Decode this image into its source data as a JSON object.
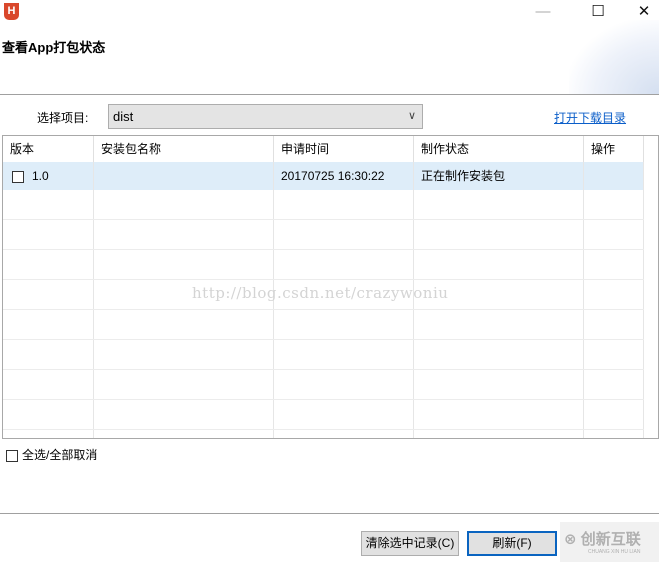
{
  "window": {
    "app_icon": "H",
    "title": "查看App打包状态",
    "minimize": "—",
    "maximize": "☐",
    "close": "✕"
  },
  "project": {
    "label": "选择项目:",
    "value": "dist",
    "open_dir_link": "打开下载目录"
  },
  "table": {
    "columns": [
      "版本",
      "安装包名称",
      "申请时间",
      "制作状态",
      "操作"
    ],
    "rows": [
      {
        "version": "1.0",
        "name": "",
        "time": "20170725 16:30:22",
        "status": "正在制作安装包",
        "action": ""
      }
    ]
  },
  "watermark": "http://blog.csdn.net/crazywoniu",
  "select_all": "全选/全部取消",
  "buttons": {
    "clear": "清除选中记录(C)",
    "refresh": "刷新(F)"
  },
  "brand": {
    "name": "创新互联",
    "sub": "CHUANG XIN HU LIAN"
  }
}
